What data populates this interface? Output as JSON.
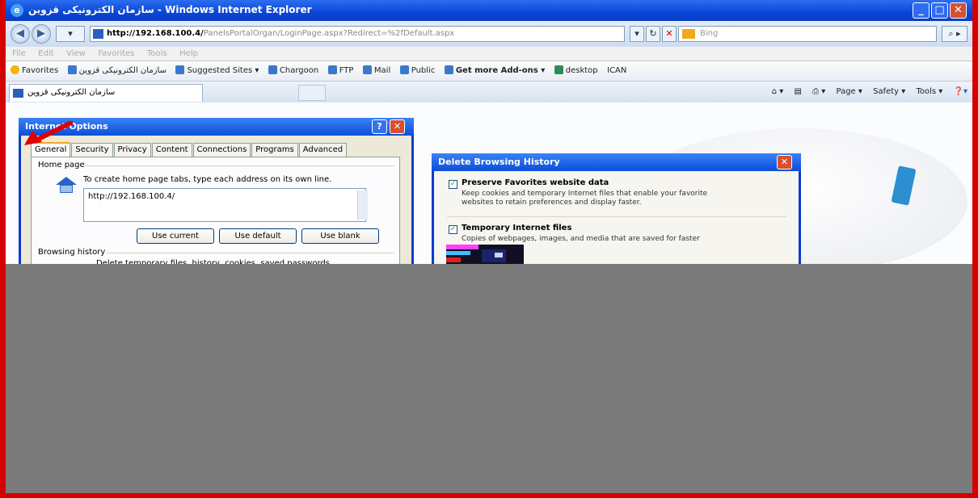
{
  "window": {
    "title": "سازمان الکترونیکی قزوین - Windows Internet Explorer",
    "buttons": {
      "minimize": "_",
      "maximize": "□",
      "close": "✕"
    }
  },
  "address_bar": {
    "url_host": "http://192.168.100.4/",
    "url_path": "PanelsPortalOrgan/LoginPage.aspx?Redirect=%2fDefault.aspx",
    "search_placeholder": "Bing"
  },
  "menu": [
    "File",
    "Edit",
    "View",
    "Favorites",
    "Tools",
    "Help"
  ],
  "favorites_bar": [
    {
      "label": "Favorites",
      "kind": "star"
    },
    {
      "label": "سازمان الکترونیکی قزوین",
      "kind": "page"
    },
    {
      "label": "Suggested Sites ▾",
      "kind": "page"
    },
    {
      "label": "Chargoon",
      "kind": "page"
    },
    {
      "label": "FTP",
      "kind": "page"
    },
    {
      "label": "Mail",
      "kind": "page"
    },
    {
      "label": "Public",
      "kind": "page"
    },
    {
      "label": "Get more Add-ons ▾",
      "kind": "page",
      "bold": true
    },
    {
      "label": "desktop",
      "kind": "page"
    },
    {
      "label": "ICAN",
      "kind": "page"
    }
  ],
  "tab": {
    "label": "سازمان الکترونیکی قزوین"
  },
  "command_bar": [
    "Page ▾",
    "Safety ▾",
    "Tools ▾"
  ],
  "internet_options": {
    "title": "Internet Options",
    "tabs": [
      "General",
      "Security",
      "Privacy",
      "Content",
      "Connections",
      "Programs",
      "Advanced"
    ],
    "home_page_label": "Home page",
    "home_page_desc": "To create home page tabs, type each address on its own line.",
    "home_page_value": "http://192.168.100.4/",
    "buttons": {
      "use_current": "Use current",
      "use_default": "Use default",
      "use_blank": "Use blank"
    },
    "browsing_history_label": "Browsing history",
    "browsing_history_desc": "Delete temporary files, history, cookies, saved passwords,"
  },
  "delete_history": {
    "title": "Delete Browsing History",
    "options": [
      {
        "title": "Preserve Favorites website data",
        "desc1": "Keep cookies and temporary Internet files that enable your favorite",
        "desc2": "websites to retain preferences and display faster.",
        "checked": true
      },
      {
        "title": "Temporary Internet files",
        "desc1": "Copies of webpages, images, and media that are saved for faster",
        "checked": true
      }
    ]
  },
  "colors": {
    "accent_red": "#d40000",
    "titlebar_blue": "#0a46d6",
    "obscured_gray": "#7a7a7a"
  }
}
